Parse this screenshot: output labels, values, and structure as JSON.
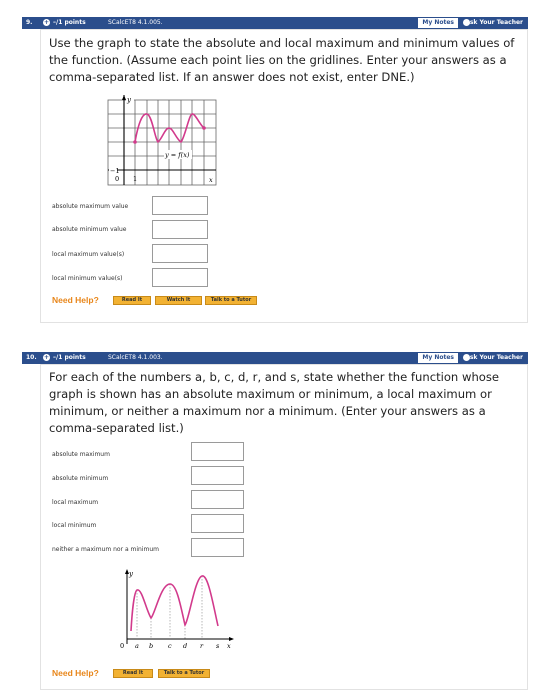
{
  "q9": {
    "number": "9.",
    "points": "–/1 points",
    "source": "SCalcET8 4.1.005.",
    "my_notes": "My Notes",
    "ask_teacher": "Ask Your Teacher",
    "text": "Use the graph to state the absolute and local maximum and minimum values of the function. (Assume each point lies on the gridlines. Enter your answers as a comma-separated list. If an answer does not exist, enter DNE.)",
    "graph": {
      "y": "y",
      "x": "x",
      "zero": "0",
      "one": "1",
      "neg_one": "−1",
      "func": "y = f(x)"
    },
    "fields": [
      {
        "label": "absolute maximum value",
        "value": ""
      },
      {
        "label": "absolute minimum value",
        "value": ""
      },
      {
        "label": "local maximum value(s)",
        "value": ""
      },
      {
        "label": "local minimum value(s)",
        "value": ""
      }
    ],
    "need_help": "Need Help?",
    "buttons": [
      "Read It",
      "Watch It",
      "Talk to a Tutor"
    ]
  },
  "q10": {
    "number": "10.",
    "points": "–/1 points",
    "source": "SCalcET8 4.1.003.",
    "my_notes": "My Notes",
    "ask_teacher": "Ask Your Teacher",
    "text": "For each of the numbers a, b, c, d, r, and s, state whether the function whose graph is shown has an absolute maximum or minimum, a local maximum or minimum, or neither a maximum nor a minimum. (Enter your answers as a comma-separated list.)",
    "graph": {
      "y": "y",
      "x": "x",
      "ticks": [
        "0",
        "a",
        "b",
        "c",
        "d",
        "r",
        "s"
      ]
    },
    "fields": [
      {
        "label": "absolute maximum",
        "value": ""
      },
      {
        "label": "absolute minimum",
        "value": ""
      },
      {
        "label": "local maximum",
        "value": ""
      },
      {
        "label": "local minimum",
        "value": ""
      },
      {
        "label": "neither a maximum nor a minimum",
        "value": ""
      }
    ],
    "need_help": "Need Help?",
    "buttons": [
      "Read It",
      "Talk to a Tutor"
    ]
  },
  "colors": {
    "header": "#2b4e8c",
    "curve": "#d23a8c",
    "help": "#e8861a",
    "button": "#f2b233"
  }
}
